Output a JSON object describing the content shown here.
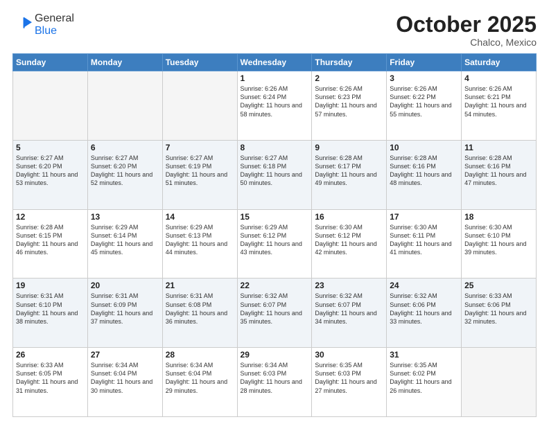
{
  "header": {
    "logo_general": "General",
    "logo_blue": "Blue",
    "month": "October 2025",
    "location": "Chalco, Mexico"
  },
  "weekdays": [
    "Sunday",
    "Monday",
    "Tuesday",
    "Wednesday",
    "Thursday",
    "Friday",
    "Saturday"
  ],
  "weeks": [
    [
      {
        "day": "",
        "empty": true
      },
      {
        "day": "",
        "empty": true
      },
      {
        "day": "",
        "empty": true
      },
      {
        "day": "1",
        "sunrise": "6:26 AM",
        "sunset": "6:24 PM",
        "daylight": "11 hours and 58 minutes."
      },
      {
        "day": "2",
        "sunrise": "6:26 AM",
        "sunset": "6:23 PM",
        "daylight": "11 hours and 57 minutes."
      },
      {
        "day": "3",
        "sunrise": "6:26 AM",
        "sunset": "6:22 PM",
        "daylight": "11 hours and 55 minutes."
      },
      {
        "day": "4",
        "sunrise": "6:26 AM",
        "sunset": "6:21 PM",
        "daylight": "11 hours and 54 minutes."
      }
    ],
    [
      {
        "day": "5",
        "sunrise": "6:27 AM",
        "sunset": "6:20 PM",
        "daylight": "11 hours and 53 minutes."
      },
      {
        "day": "6",
        "sunrise": "6:27 AM",
        "sunset": "6:20 PM",
        "daylight": "11 hours and 52 minutes."
      },
      {
        "day": "7",
        "sunrise": "6:27 AM",
        "sunset": "6:19 PM",
        "daylight": "11 hours and 51 minutes."
      },
      {
        "day": "8",
        "sunrise": "6:27 AM",
        "sunset": "6:18 PM",
        "daylight": "11 hours and 50 minutes."
      },
      {
        "day": "9",
        "sunrise": "6:28 AM",
        "sunset": "6:17 PM",
        "daylight": "11 hours and 49 minutes."
      },
      {
        "day": "10",
        "sunrise": "6:28 AM",
        "sunset": "6:16 PM",
        "daylight": "11 hours and 48 minutes."
      },
      {
        "day": "11",
        "sunrise": "6:28 AM",
        "sunset": "6:16 PM",
        "daylight": "11 hours and 47 minutes."
      }
    ],
    [
      {
        "day": "12",
        "sunrise": "6:28 AM",
        "sunset": "6:15 PM",
        "daylight": "11 hours and 46 minutes."
      },
      {
        "day": "13",
        "sunrise": "6:29 AM",
        "sunset": "6:14 PM",
        "daylight": "11 hours and 45 minutes."
      },
      {
        "day": "14",
        "sunrise": "6:29 AM",
        "sunset": "6:13 PM",
        "daylight": "11 hours and 44 minutes."
      },
      {
        "day": "15",
        "sunrise": "6:29 AM",
        "sunset": "6:12 PM",
        "daylight": "11 hours and 43 minutes."
      },
      {
        "day": "16",
        "sunrise": "6:30 AM",
        "sunset": "6:12 PM",
        "daylight": "11 hours and 42 minutes."
      },
      {
        "day": "17",
        "sunrise": "6:30 AM",
        "sunset": "6:11 PM",
        "daylight": "11 hours and 41 minutes."
      },
      {
        "day": "18",
        "sunrise": "6:30 AM",
        "sunset": "6:10 PM",
        "daylight": "11 hours and 39 minutes."
      }
    ],
    [
      {
        "day": "19",
        "sunrise": "6:31 AM",
        "sunset": "6:10 PM",
        "daylight": "11 hours and 38 minutes."
      },
      {
        "day": "20",
        "sunrise": "6:31 AM",
        "sunset": "6:09 PM",
        "daylight": "11 hours and 37 minutes."
      },
      {
        "day": "21",
        "sunrise": "6:31 AM",
        "sunset": "6:08 PM",
        "daylight": "11 hours and 36 minutes."
      },
      {
        "day": "22",
        "sunrise": "6:32 AM",
        "sunset": "6:07 PM",
        "daylight": "11 hours and 35 minutes."
      },
      {
        "day": "23",
        "sunrise": "6:32 AM",
        "sunset": "6:07 PM",
        "daylight": "11 hours and 34 minutes."
      },
      {
        "day": "24",
        "sunrise": "6:32 AM",
        "sunset": "6:06 PM",
        "daylight": "11 hours and 33 minutes."
      },
      {
        "day": "25",
        "sunrise": "6:33 AM",
        "sunset": "6:06 PM",
        "daylight": "11 hours and 32 minutes."
      }
    ],
    [
      {
        "day": "26",
        "sunrise": "6:33 AM",
        "sunset": "6:05 PM",
        "daylight": "11 hours and 31 minutes."
      },
      {
        "day": "27",
        "sunrise": "6:34 AM",
        "sunset": "6:04 PM",
        "daylight": "11 hours and 30 minutes."
      },
      {
        "day": "28",
        "sunrise": "6:34 AM",
        "sunset": "6:04 PM",
        "daylight": "11 hours and 29 minutes."
      },
      {
        "day": "29",
        "sunrise": "6:34 AM",
        "sunset": "6:03 PM",
        "daylight": "11 hours and 28 minutes."
      },
      {
        "day": "30",
        "sunrise": "6:35 AM",
        "sunset": "6:03 PM",
        "daylight": "11 hours and 27 minutes."
      },
      {
        "day": "31",
        "sunrise": "6:35 AM",
        "sunset": "6:02 PM",
        "daylight": "11 hours and 26 minutes."
      },
      {
        "day": "",
        "empty": true
      }
    ]
  ],
  "labels": {
    "sunrise": "Sunrise:",
    "sunset": "Sunset:",
    "daylight": "Daylight:"
  }
}
